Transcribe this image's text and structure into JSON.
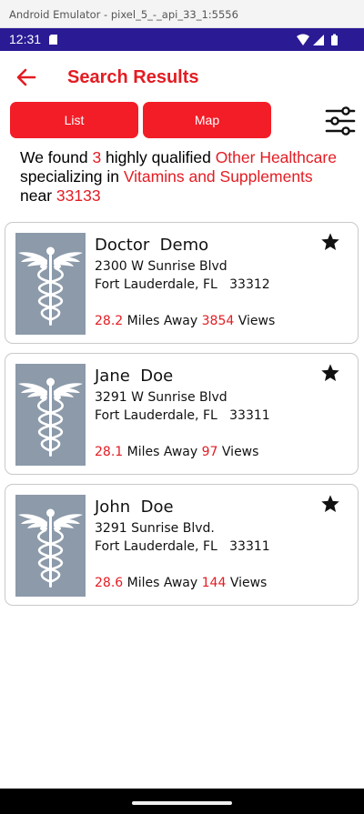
{
  "window": {
    "title": "Android Emulator - pixel_5_-_api_33_1:5556"
  },
  "status_bar": {
    "time": "12:31",
    "icons": [
      "sd-card-icon",
      "wifi-icon",
      "signal-icon",
      "battery-icon"
    ],
    "color": "#2a1a94"
  },
  "app_bar": {
    "title": "Search Results",
    "back_icon": "arrow-back-icon",
    "accent": "#e31c23"
  },
  "tabs": {
    "list_label": "List",
    "map_label": "Map",
    "button_color": "#f31d27"
  },
  "filter": {
    "icon": "sliders-icon"
  },
  "summary": {
    "p1": "We found ",
    "count": "3",
    "p2": " highly qualified ",
    "category": "Other Healthcare",
    "p3": " specializing in ",
    "specialty": "Vitamins and Supplements",
    "p4": " near ",
    "zip": "33133"
  },
  "results": [
    {
      "name": "Doctor  Demo",
      "address1": "2300 W Sunrise Blvd",
      "address2": "Fort Lauderdale, FL   33312",
      "distance": "28.2",
      "distance_label": "Miles Away",
      "views": "3854",
      "views_label": "Views",
      "icon": "caduceus-icon"
    },
    {
      "name": "Jane  Doe",
      "address1": "3291 W Sunrise Blvd",
      "address2": "Fort Lauderdale, FL   33311",
      "distance": "28.1",
      "distance_label": "Miles Away",
      "views": "97",
      "views_label": "Views",
      "icon": "caduceus-icon"
    },
    {
      "name": "John  Doe",
      "address1": "3291 Sunrise Blvd.",
      "address2": "Fort Lauderdale, FL   33311",
      "distance": "28.6",
      "distance_label": "Miles Away",
      "views": "144",
      "views_label": "Views",
      "icon": "caduceus-icon"
    }
  ]
}
